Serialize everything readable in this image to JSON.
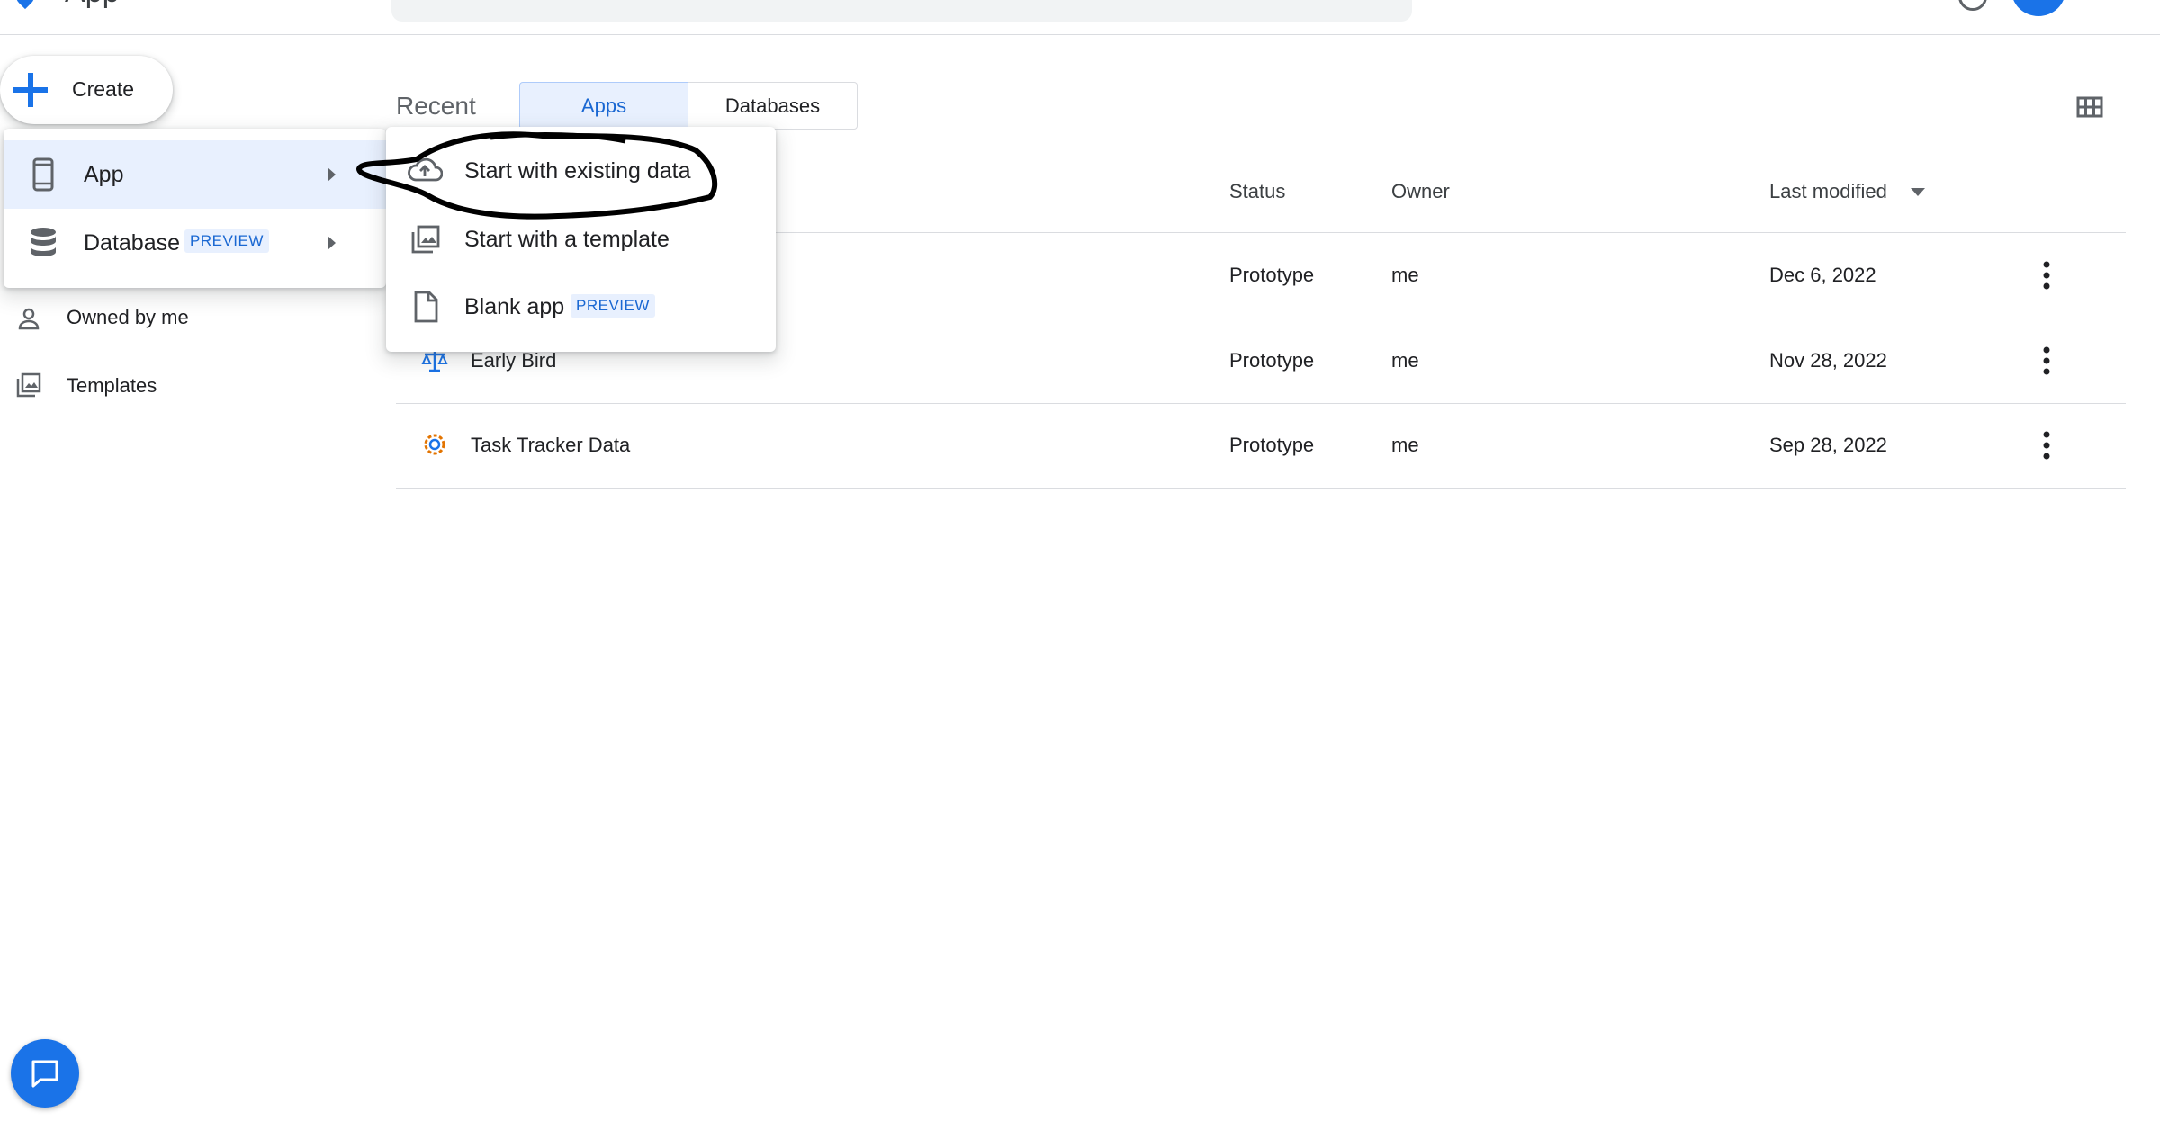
{
  "header": {
    "app_name": "App",
    "search_placeholder": ""
  },
  "create_button": {
    "label": "Create"
  },
  "sidebar": {
    "items": [
      {
        "label": "Owned by me",
        "icon": "person-icon"
      },
      {
        "label": "Templates",
        "icon": "templates-icon"
      }
    ]
  },
  "create_menu": {
    "items": [
      {
        "label": "App",
        "icon": "phone-icon",
        "badge": ""
      },
      {
        "label": "Database",
        "icon": "database-icon",
        "badge": "PREVIEW"
      }
    ]
  },
  "app_submenu": {
    "items": [
      {
        "label": "Start with existing data",
        "icon": "cloud-upload-icon",
        "badge": ""
      },
      {
        "label": "Start with a template",
        "icon": "template-icon",
        "badge": ""
      },
      {
        "label": "Blank app",
        "icon": "document-icon",
        "badge": "PREVIEW"
      }
    ]
  },
  "recent": {
    "title": "Recent",
    "tabs": [
      {
        "label": "Apps",
        "selected": true
      },
      {
        "label": "Databases",
        "selected": false
      }
    ]
  },
  "table": {
    "columns": {
      "status": "Status",
      "owner": "Owner",
      "last_modified": "Last modified"
    },
    "rows": [
      {
        "name": "",
        "status": "Prototype",
        "owner": "me",
        "last_modified": "Dec 6, 2022",
        "icon": "app-icon"
      },
      {
        "name": "Early Bird",
        "status": "Prototype",
        "owner": "me",
        "last_modified": "Nov 28, 2022",
        "icon": "scale-icon"
      },
      {
        "name": "Task Tracker Data",
        "status": "Prototype",
        "owner": "me",
        "last_modified": "Sep 28, 2022",
        "icon": "gear-icon"
      }
    ]
  },
  "colors": {
    "accent": "#1a73e8",
    "selected_bg": "#e8f0fe",
    "divider": "#dadce0"
  }
}
